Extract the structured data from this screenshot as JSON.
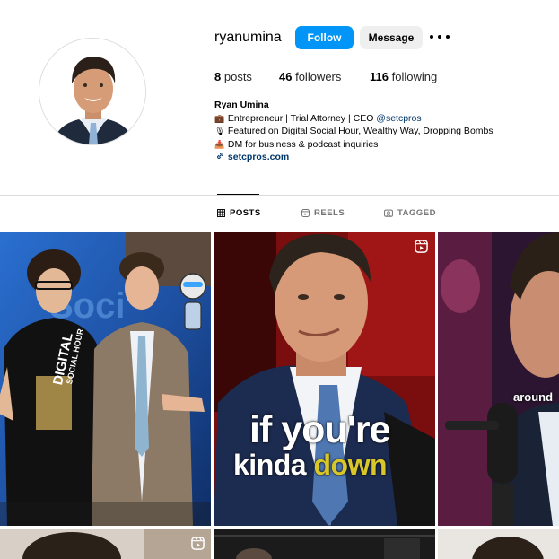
{
  "profile": {
    "username": "ryanumina",
    "follow_label": "Follow",
    "message_label": "Message",
    "stats": {
      "posts_count": "8",
      "posts_label": "posts",
      "followers_count": "46",
      "followers_label": "followers",
      "following_count": "116",
      "following_label": "following"
    },
    "bio": {
      "name": "Ryan Umina",
      "line1_emoji": "💼",
      "line1_text": "Entrepreneur | Trial Attorney | CEO ",
      "line1_mention": "@setcpros",
      "line2_emoji": "🎙",
      "line2_text": "Featured on Digital Social Hour, Wealthy Way, Dropping Bombs",
      "line3_emoji": "📥",
      "line3_text": "DM for business & podcast inquiries",
      "link": "setcpros.com"
    }
  },
  "tabs": [
    {
      "label": "POSTS",
      "icon": "grid-icon",
      "active": true
    },
    {
      "label": "REELS",
      "icon": "reels-icon",
      "active": false
    },
    {
      "label": "TAGGED",
      "icon": "tagged-icon",
      "active": false
    }
  ],
  "posts": [
    {
      "kind": "photo",
      "overlay_text": [
        "DIGITAL",
        "SOCIAL HOUR"
      ]
    },
    {
      "kind": "reel",
      "overlay_line1": "if you're",
      "overlay_line2a": "kinda ",
      "overlay_line2b": "down"
    },
    {
      "kind": "reel",
      "overlay_text": "around"
    }
  ],
  "colors": {
    "accent": "#0095f6",
    "caption_highlight": "#d9c72a",
    "link": "#00376b"
  }
}
